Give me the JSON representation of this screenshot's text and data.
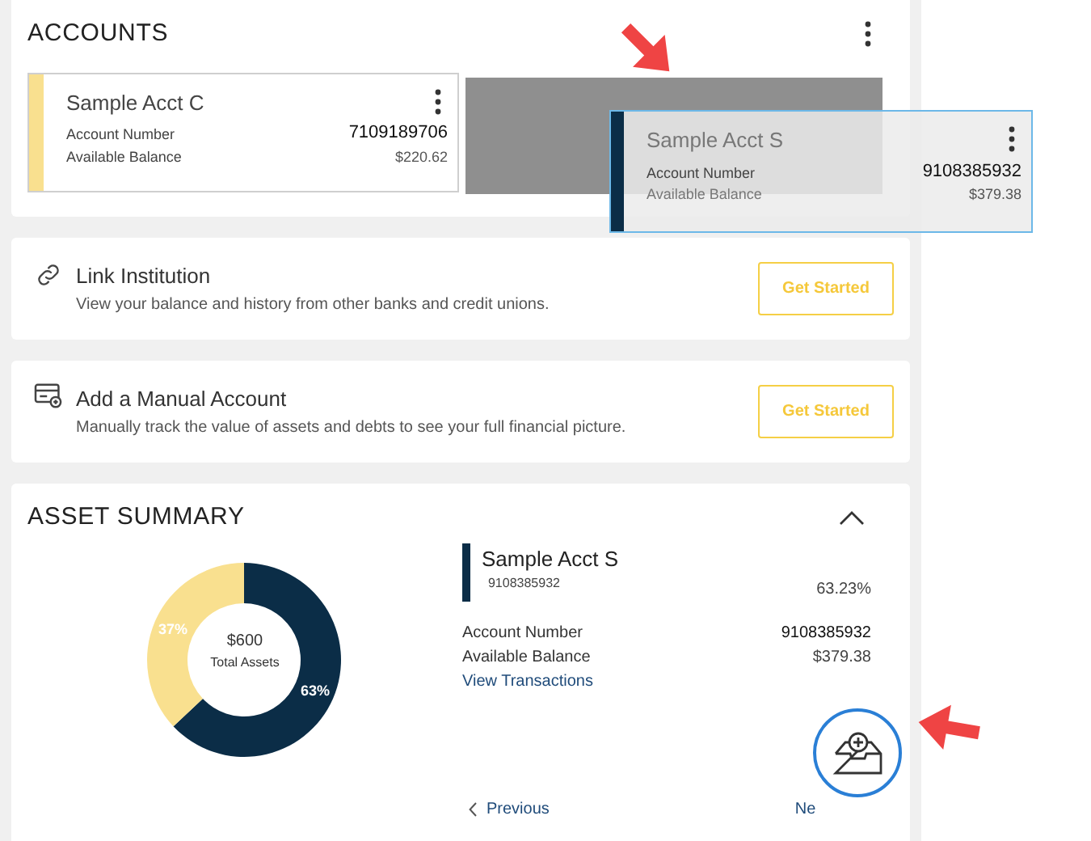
{
  "accounts": {
    "title": "ACCOUNTS",
    "cards": [
      {
        "name": "Sample Acct C",
        "number_label": "Account Number",
        "number": "7109189706",
        "balance_label": "Available Balance",
        "balance": "$220.62",
        "color": "#f9e08f",
        "dragging": false
      },
      {
        "name": "Sample Acct S",
        "number_label": "Account Number",
        "number": "9108385932",
        "balance_label": "Available Balance",
        "balance": "$379.38",
        "color": "#0b2d47",
        "dragging": true
      }
    ]
  },
  "actions": [
    {
      "kind": "link",
      "title": "Link Institution",
      "description": "View your balance and history from other banks and credit unions.",
      "button": "Get Started"
    },
    {
      "kind": "manual",
      "title": "Add a Manual Account",
      "description": "Manually track the value of assets and debts to see your full financial picture.",
      "button": "Get Started"
    }
  ],
  "asset_summary": {
    "title": "ASSET SUMMARY",
    "expanded": true,
    "total": "$600",
    "total_label": "Total Assets",
    "chart_data": {
      "type": "donut",
      "values": [
        63,
        37
      ],
      "colors": [
        "#0b2d47",
        "#f9e08f"
      ],
      "value_labels": [
        "63%",
        "37%"
      ]
    },
    "account": {
      "name": "Sample Acct S",
      "sub_number": "9108385932",
      "percent": "63.23%",
      "number_label": "Account Number",
      "number": "9108385932",
      "balance_label": "Available Balance",
      "balance": "$379.38",
      "link": "View Transactions",
      "color": "#0b2d47"
    },
    "previous": "Previous",
    "next": "Ne"
  }
}
